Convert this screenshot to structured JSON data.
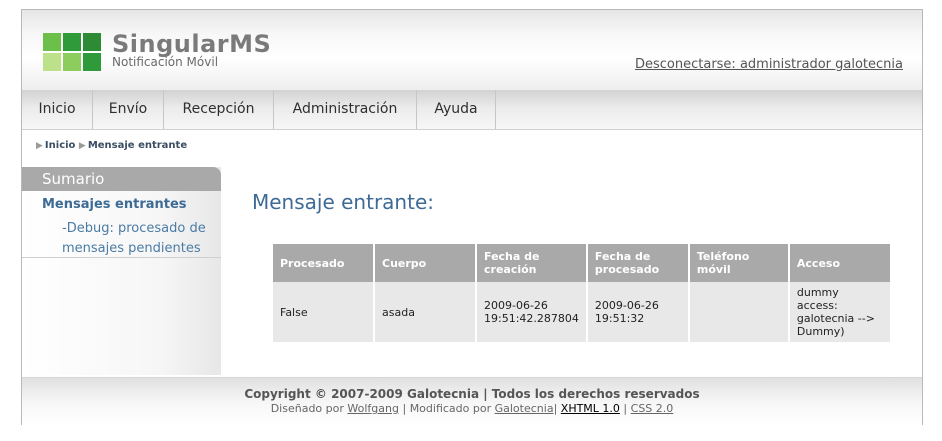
{
  "header": {
    "app_name": "SingularMS",
    "subtitle": "Notificación Móvil",
    "logout": "Desconectarse: administrador galotecnia"
  },
  "logo_colors": [
    "#6cbf49",
    "#2f9a3a",
    "#2e8b35",
    "#bde08a",
    "#8ccd5e",
    "#6dbf4a"
  ],
  "nav": {
    "items": [
      {
        "label": "Inicio"
      },
      {
        "label": "Envío"
      },
      {
        "label": "Recepción"
      },
      {
        "label": "Administración"
      },
      {
        "label": "Ayuda"
      }
    ]
  },
  "breadcrumb": {
    "items": [
      "Inicio",
      "Mensaje entrante"
    ]
  },
  "sidebar": {
    "title": "Sumario",
    "link": "Mensajes entrantes",
    "sub_link": "-Debug: procesado de mensajes pendientes"
  },
  "main": {
    "title": "Mensaje entrante:",
    "table": {
      "headers": [
        "Procesado",
        "Cuerpo",
        "Fecha de creación",
        "Fecha de procesado",
        "Teléfono móvil",
        "Acceso"
      ],
      "rows": [
        [
          "False",
          "asada",
          "2009-06-26 19:51:42.287804",
          "2009-06-26 19:51:32",
          "",
          "dummy access: galotecnia --> Dummy)"
        ]
      ]
    }
  },
  "footer": {
    "copyright": "Copyright © 2007-2009 Galotecnia | Todos los derechos reservados",
    "designed_by": "Diseñado por",
    "designer": "Wolfgang",
    "sep1": "|",
    "modified_by": "Modificado por",
    "modifier": "Galotecnia",
    "sep2": "|",
    "xhtml": "XHTML 1.0",
    "sep3": "|",
    "css": "CSS 2.0"
  }
}
